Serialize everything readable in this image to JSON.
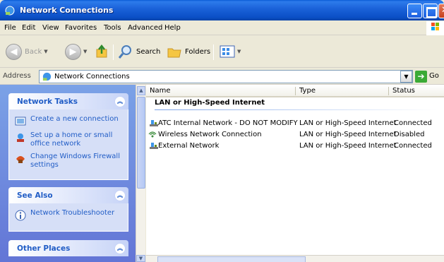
{
  "window": {
    "title": "Network Connections"
  },
  "menu": [
    "File",
    "Edit",
    "View",
    "Favorites",
    "Tools",
    "Advanced",
    "Help"
  ],
  "toolbar": {
    "back": "Back",
    "search": "Search",
    "folders": "Folders"
  },
  "address": {
    "label": "Address",
    "value": "Network Connections",
    "go": "Go"
  },
  "taskpane": {
    "network_tasks": {
      "title": "Network Tasks",
      "items": [
        "Create a new connection",
        "Set up a home or small office network",
        "Change Windows Firewall settings"
      ]
    },
    "see_also": {
      "title": "See Also",
      "items": [
        "Network Troubleshooter"
      ]
    },
    "other_places": {
      "title": "Other Places"
    }
  },
  "list": {
    "columns": [
      "Name",
      "Type",
      "Status"
    ],
    "group": "LAN or High-Speed Internet",
    "rows": [
      {
        "name": "ATC Internal Network - DO NOT MODIFY",
        "type": "LAN or High-Speed Internet",
        "status": "Connected",
        "icon": "lan-connection-icon"
      },
      {
        "name": "Wireless Network Connection",
        "type": "LAN or High-Speed Internet",
        "status": "Disabled",
        "icon": "wireless-connection-icon"
      },
      {
        "name": "External Network",
        "type": "LAN or High-Speed Internet",
        "status": "Connected",
        "icon": "lan-connection-icon"
      }
    ]
  }
}
